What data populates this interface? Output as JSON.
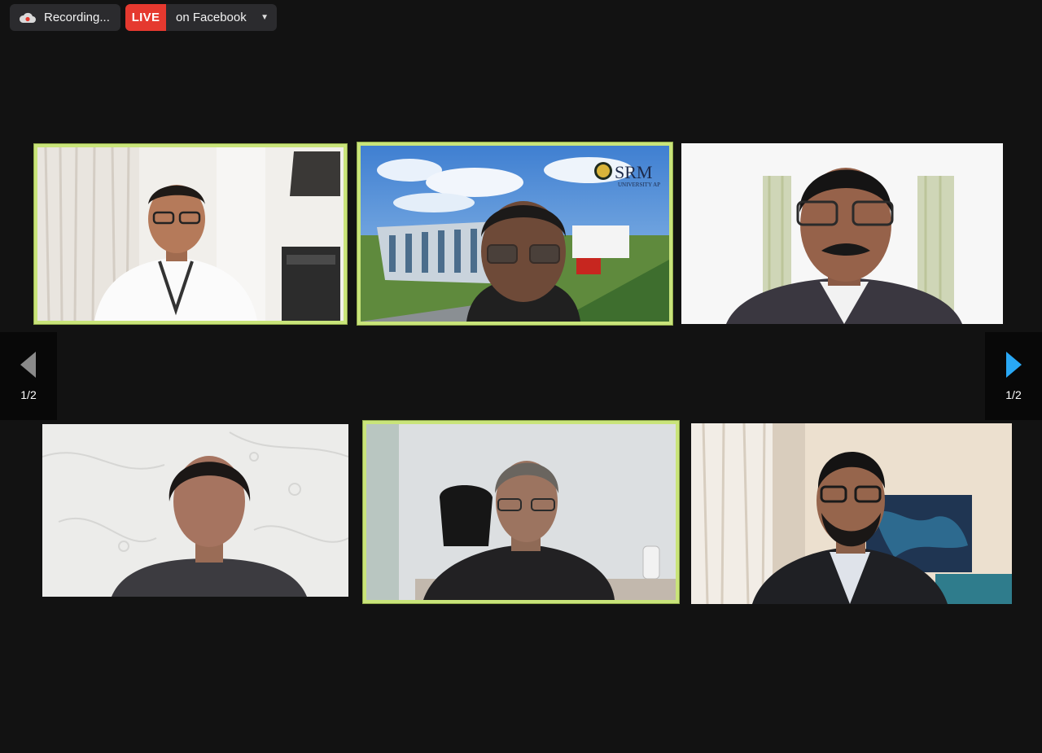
{
  "recording": {
    "label": "Recording..."
  },
  "live": {
    "badge": "LIVE",
    "label": "on Facebook"
  },
  "navigation": {
    "prev_page": "1/2",
    "next_page": "1/2"
  },
  "logo": {
    "text": "SRM",
    "subtitle": "UNIVERSITY AP"
  },
  "colors": {
    "active_speaker_border": "#c9e47a",
    "live_red": "#e5392f",
    "nav_arrow_active": "#29a8f5",
    "nav_arrow_inactive": "#8a8a8a"
  }
}
